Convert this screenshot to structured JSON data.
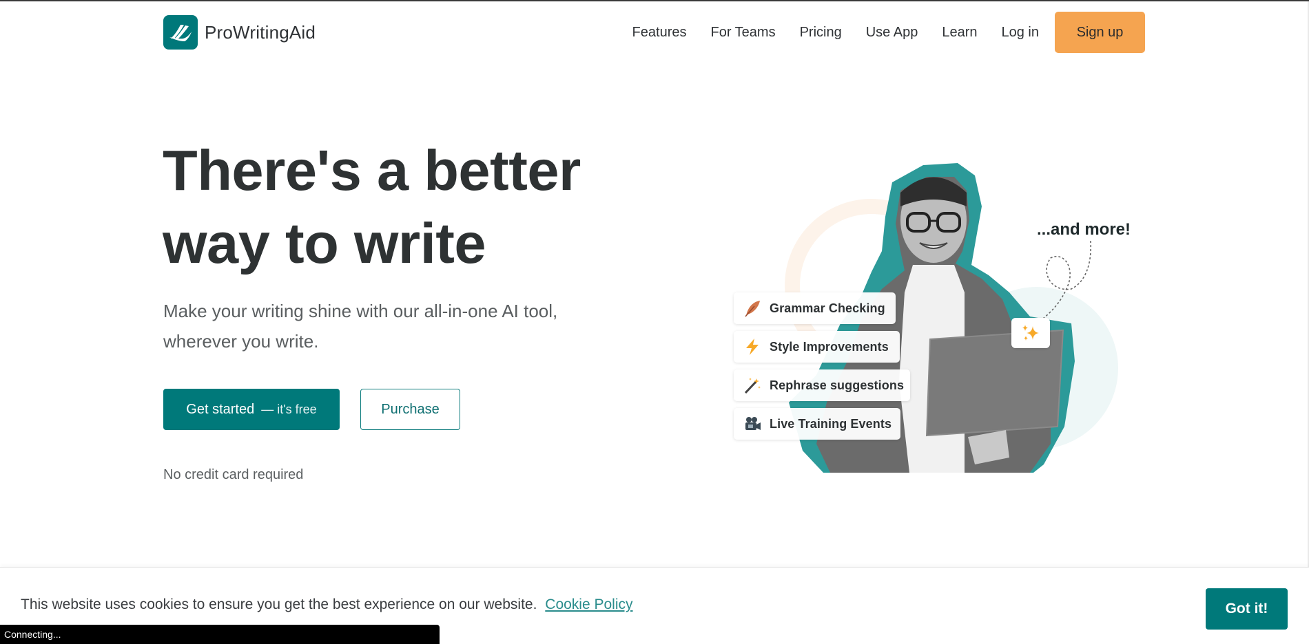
{
  "header": {
    "brand": "ProWritingAid",
    "nav": [
      "Features",
      "For Teams",
      "Pricing",
      "Use App",
      "Learn",
      "Log in"
    ],
    "signup_label": "Sign up"
  },
  "hero": {
    "title_line1": "There's a better",
    "title_line2": "way to write",
    "subtitle_line1": "Make your writing shine with our all-in-one AI tool,",
    "subtitle_line2": "wherever you write.",
    "primary_cta": "Get started",
    "primary_cta_suffix": "— it's free",
    "secondary_cta": "Purchase",
    "note": "No credit card required"
  },
  "illustration": {
    "features": [
      {
        "icon": "feather-icon",
        "label": "Grammar Checking"
      },
      {
        "icon": "lightning-icon",
        "label": "Style Improvements"
      },
      {
        "icon": "magic-wand-icon",
        "label": "Rephrase suggestions"
      },
      {
        "icon": "video-camera-icon",
        "label": "Live Training Events"
      }
    ],
    "and_more": "...and more!"
  },
  "cookie_banner": {
    "message": "This website uses cookies to ensure you get the best experience on our website.",
    "policy_link": "Cookie Policy",
    "accept_label": "Got it!"
  },
  "status_bar": {
    "text": "Connecting..."
  },
  "colors": {
    "brand_teal": "#00797a",
    "signup_orange": "#f5a450",
    "text_dark": "#2e3233"
  }
}
